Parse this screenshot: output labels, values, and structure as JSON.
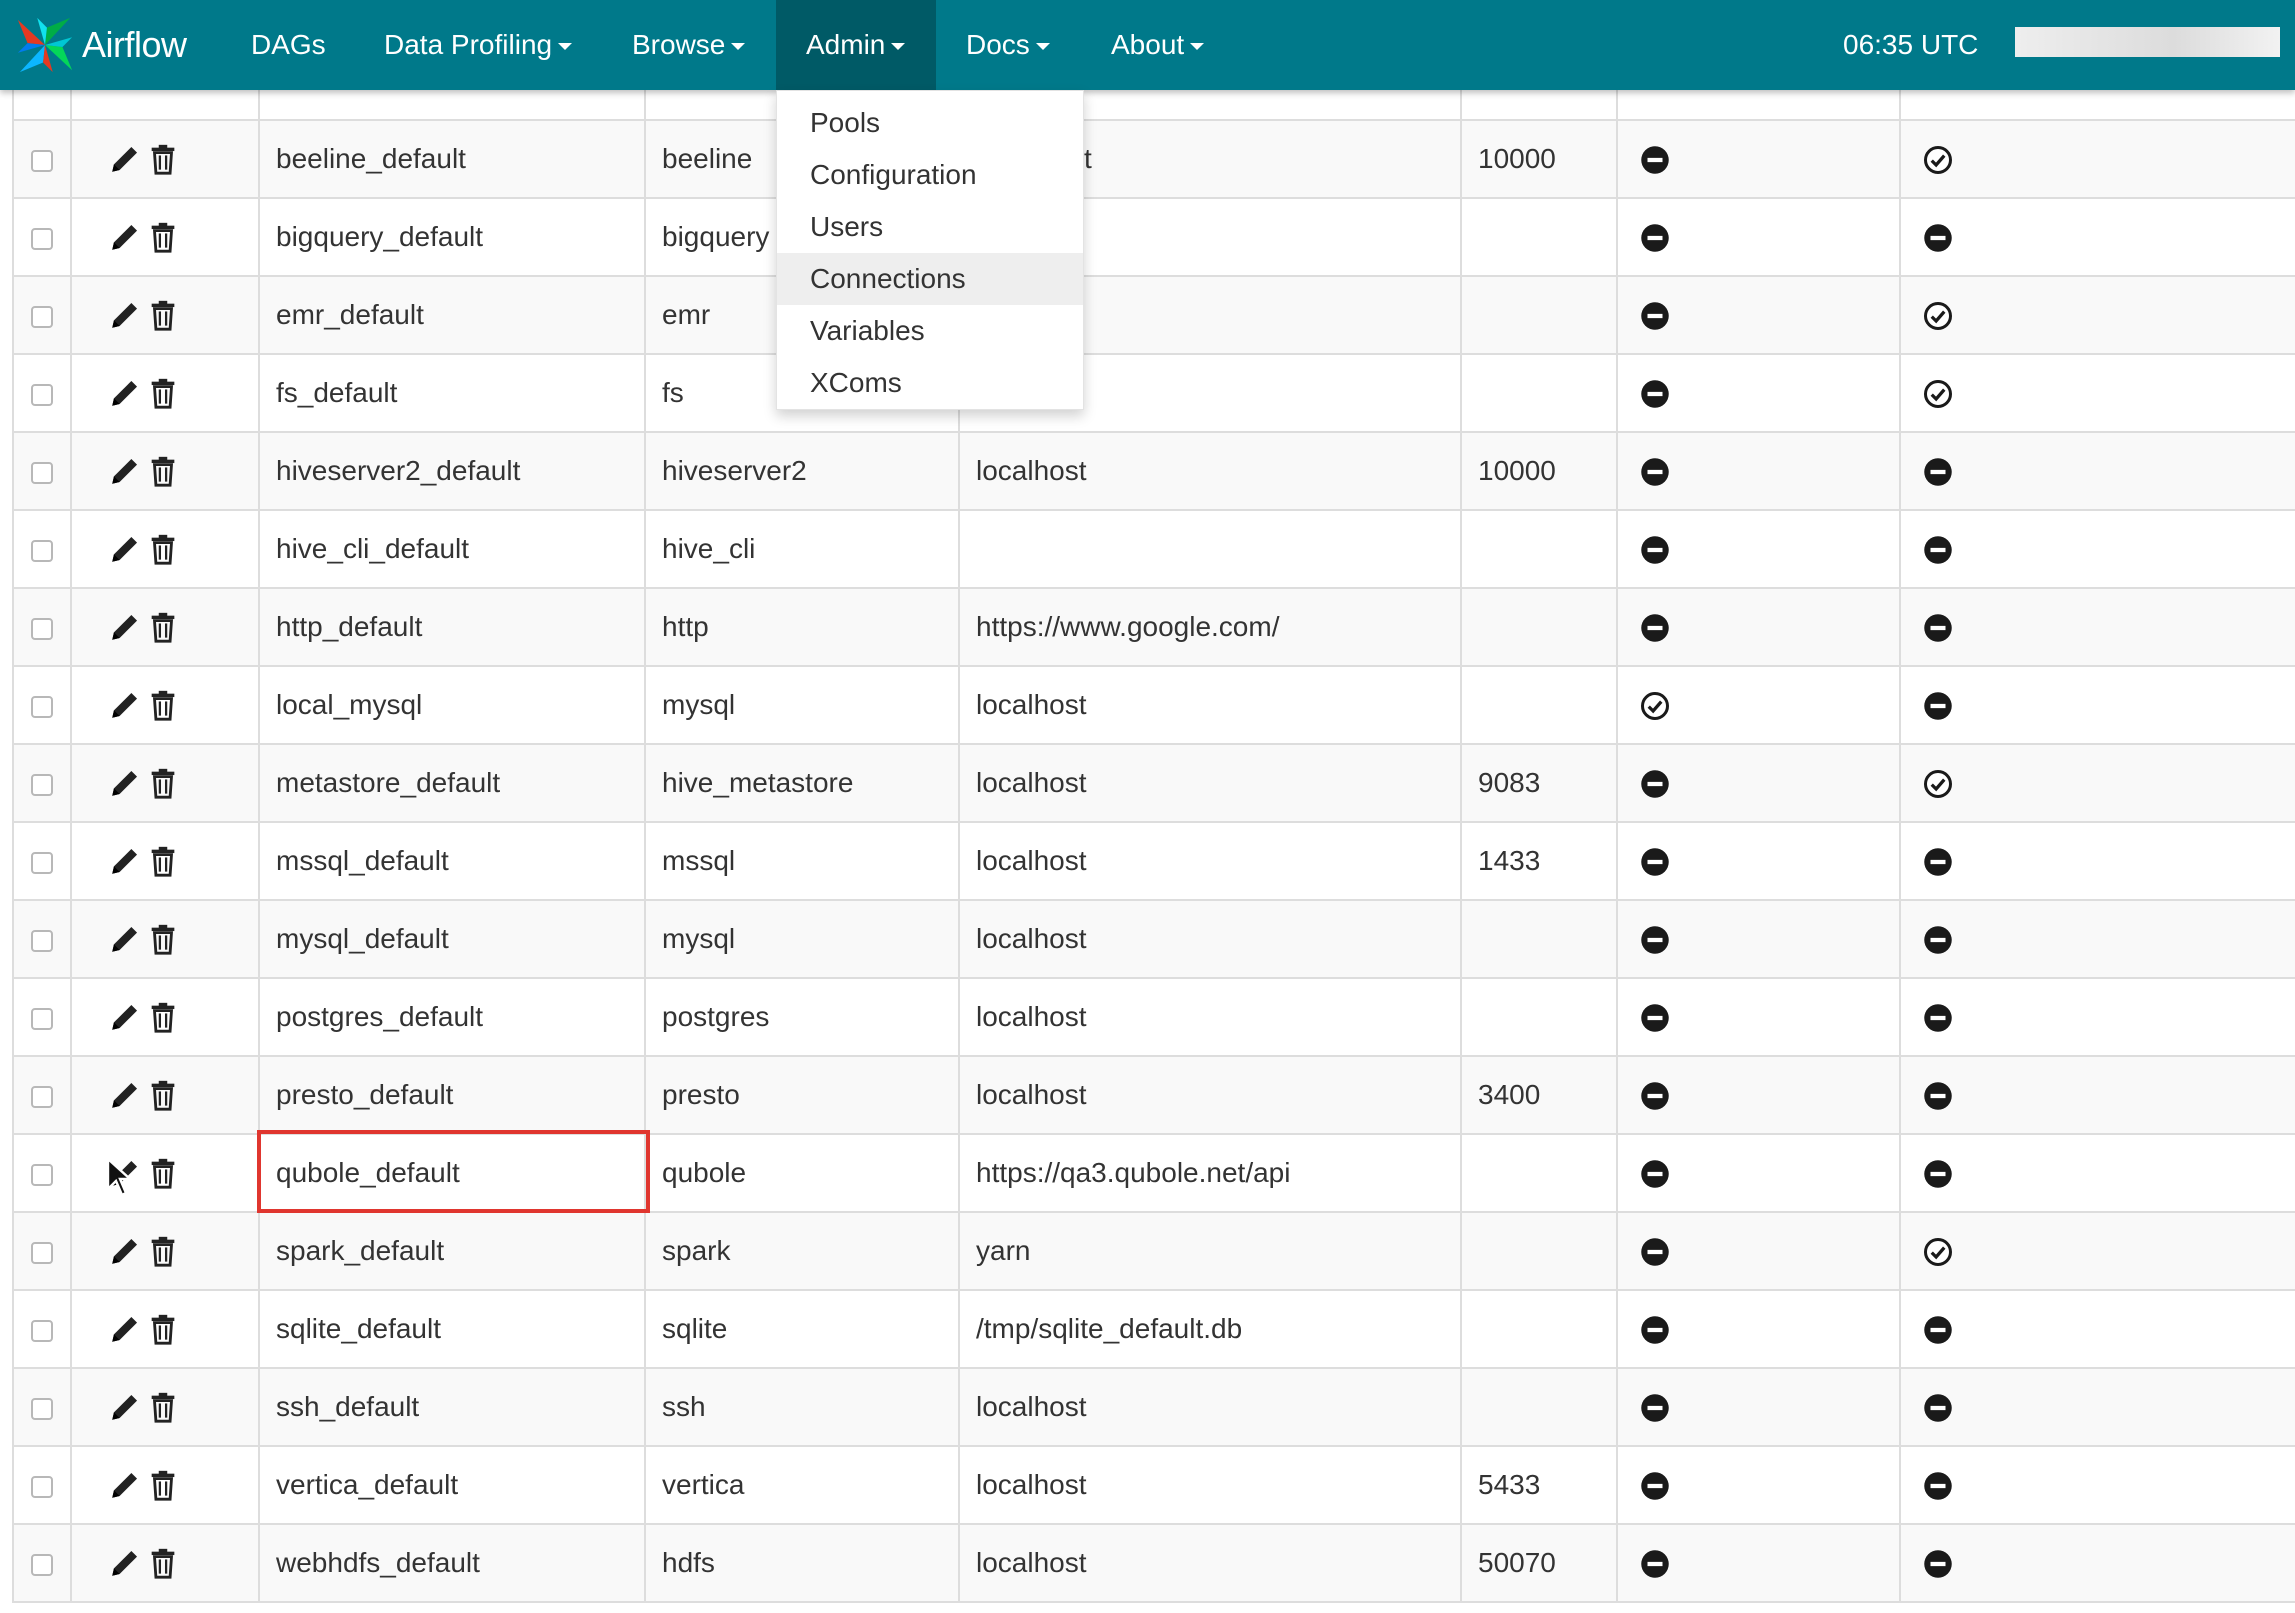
{
  "navbar": {
    "brand": "Airflow",
    "items": [
      {
        "label": "DAGs",
        "caret": false
      },
      {
        "label": "Data Profiling",
        "caret": true
      },
      {
        "label": "Browse",
        "caret": true
      },
      {
        "label": "Admin",
        "caret": true,
        "active": true
      },
      {
        "label": "Docs",
        "caret": true
      },
      {
        "label": "About",
        "caret": true
      }
    ],
    "time": "06:35 UTC",
    "color": "#00798a",
    "active_color": "#005a66"
  },
  "admin_menu": {
    "items": [
      "Pools",
      "Configuration",
      "Users",
      "Connections",
      "Variables",
      "XComs"
    ],
    "selected": "Connections"
  },
  "connections": {
    "header_partial_host": "t",
    "rows": [
      {
        "conn_id": "beeline_default",
        "conn_type": "beeline",
        "host": "",
        "port": "10000",
        "is_encrypted": false,
        "is_extra_encrypted": true
      },
      {
        "conn_id": "bigquery_default",
        "conn_type": "bigquery",
        "host": "",
        "port": "",
        "is_encrypted": false,
        "is_extra_encrypted": false
      },
      {
        "conn_id": "emr_default",
        "conn_type": "emr",
        "host": "",
        "port": "",
        "is_encrypted": false,
        "is_extra_encrypted": true
      },
      {
        "conn_id": "fs_default",
        "conn_type": "fs",
        "host": "",
        "port": "",
        "is_encrypted": false,
        "is_extra_encrypted": true
      },
      {
        "conn_id": "hiveserver2_default",
        "conn_type": "hiveserver2",
        "host": "localhost",
        "port": "10000",
        "is_encrypted": false,
        "is_extra_encrypted": false
      },
      {
        "conn_id": "hive_cli_default",
        "conn_type": "hive_cli",
        "host": "",
        "port": "",
        "is_encrypted": false,
        "is_extra_encrypted": false
      },
      {
        "conn_id": "http_default",
        "conn_type": "http",
        "host": "https://www.google.com/",
        "port": "",
        "is_encrypted": false,
        "is_extra_encrypted": false
      },
      {
        "conn_id": "local_mysql",
        "conn_type": "mysql",
        "host": "localhost",
        "port": "",
        "is_encrypted": true,
        "is_extra_encrypted": false
      },
      {
        "conn_id": "metastore_default",
        "conn_type": "hive_metastore",
        "host": "localhost",
        "port": "9083",
        "is_encrypted": false,
        "is_extra_encrypted": true
      },
      {
        "conn_id": "mssql_default",
        "conn_type": "mssql",
        "host": "localhost",
        "port": "1433",
        "is_encrypted": false,
        "is_extra_encrypted": false
      },
      {
        "conn_id": "mysql_default",
        "conn_type": "mysql",
        "host": "localhost",
        "port": "",
        "is_encrypted": false,
        "is_extra_encrypted": false
      },
      {
        "conn_id": "postgres_default",
        "conn_type": "postgres",
        "host": "localhost",
        "port": "",
        "is_encrypted": false,
        "is_extra_encrypted": false
      },
      {
        "conn_id": "presto_default",
        "conn_type": "presto",
        "host": "localhost",
        "port": "3400",
        "is_encrypted": false,
        "is_extra_encrypted": false
      },
      {
        "conn_id": "qubole_default",
        "conn_type": "qubole",
        "host": "https://qa3.qubole.net/api",
        "port": "",
        "is_encrypted": false,
        "is_extra_encrypted": false,
        "highlighted": true
      },
      {
        "conn_id": "spark_default",
        "conn_type": "spark",
        "host": "yarn",
        "port": "",
        "is_encrypted": false,
        "is_extra_encrypted": true
      },
      {
        "conn_id": "sqlite_default",
        "conn_type": "sqlite",
        "host": "/tmp/sqlite_default.db",
        "port": "",
        "is_encrypted": false,
        "is_extra_encrypted": false
      },
      {
        "conn_id": "ssh_default",
        "conn_type": "ssh",
        "host": "localhost",
        "port": "",
        "is_encrypted": false,
        "is_extra_encrypted": false
      },
      {
        "conn_id": "vertica_default",
        "conn_type": "vertica",
        "host": "localhost",
        "port": "5433",
        "is_encrypted": false,
        "is_extra_encrypted": false
      },
      {
        "conn_id": "webhdfs_default",
        "conn_type": "hdfs",
        "host": "localhost",
        "port": "50070",
        "is_encrypted": false,
        "is_extra_encrypted": false
      }
    ]
  },
  "icons": {
    "edit": "pencil-icon",
    "delete": "trash-icon",
    "true": "check-circle-icon",
    "false": "minus-circle-icon"
  },
  "colors": {
    "highlight_border": "#e0362f"
  }
}
